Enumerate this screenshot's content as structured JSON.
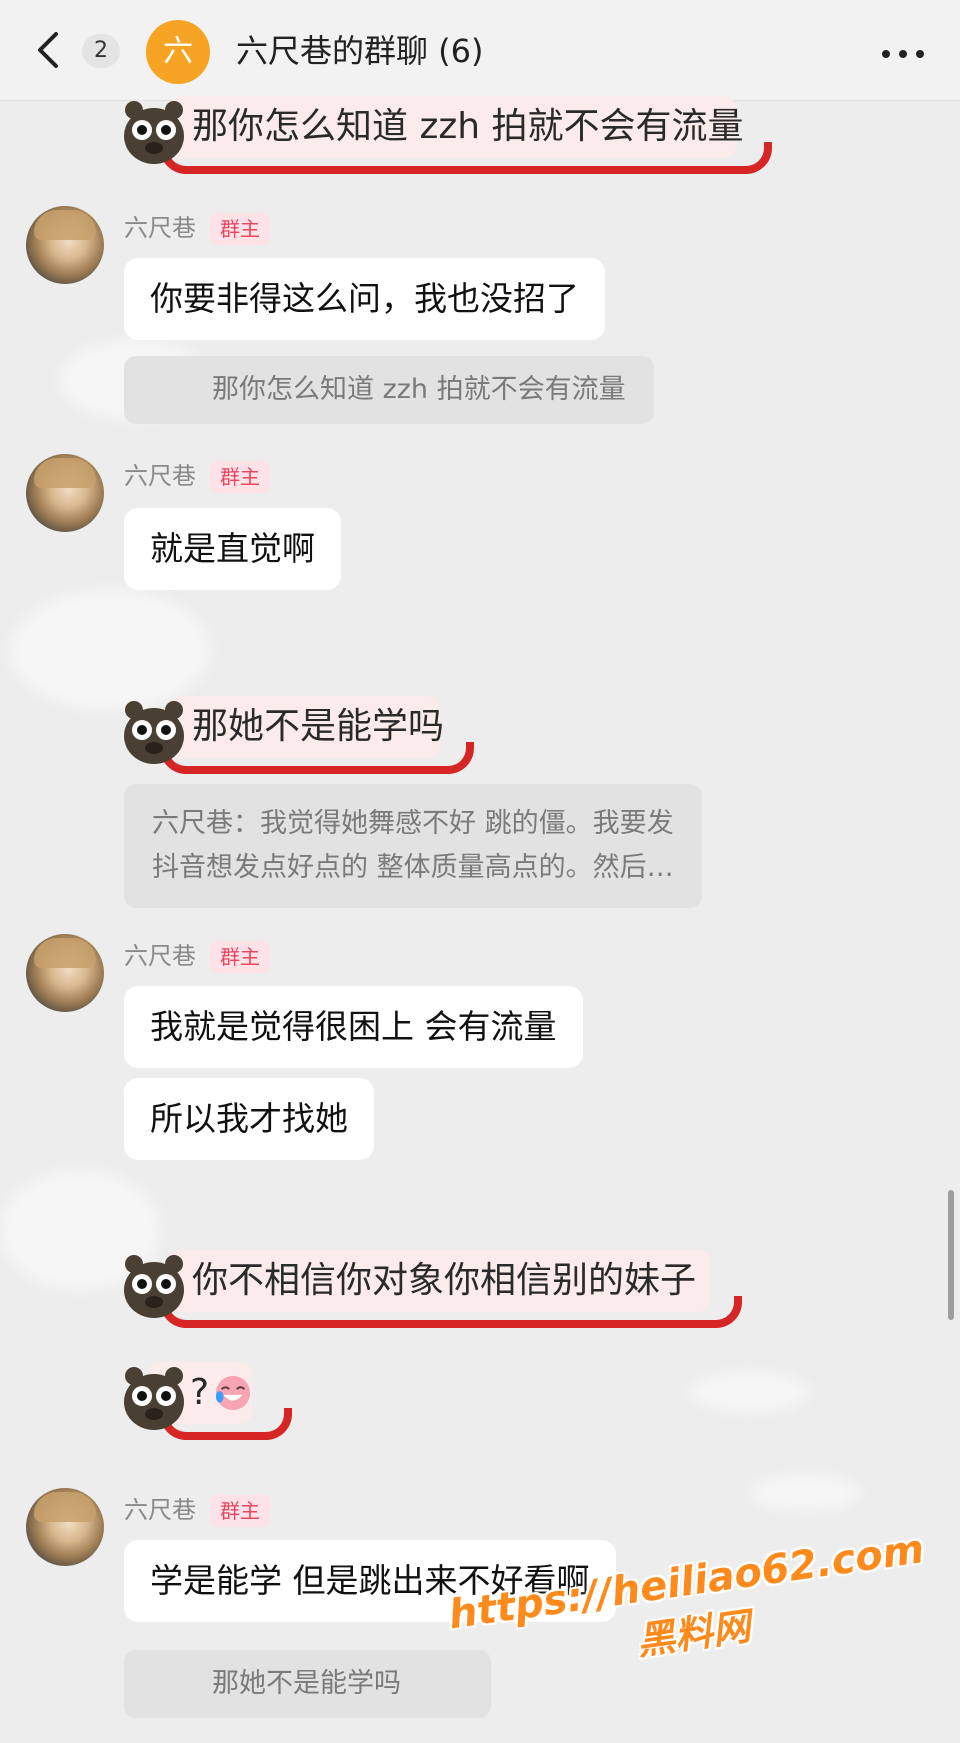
{
  "header": {
    "back_icon": "chevron-left-icon",
    "unread_count": "2",
    "group_avatar_text": "六",
    "title": "六尺巷的群聊 (6)",
    "more_icon": "more-horizontal-icon"
  },
  "messages": {
    "m1_text": "那你怎么知道 zzh 拍就不会有流量",
    "m2_name": "六尺巷",
    "m2_badge": "群主",
    "m2_text": "你要非得这么问，我也没招了",
    "m2_quote": "那你怎么知道 zzh 拍就不会有流量",
    "m3_name": "六尺巷",
    "m3_badge": "群主",
    "m3_text": "就是直觉啊",
    "m4_text": "那她不是能学吗",
    "m4_quote_line1": "六尺巷：我觉得她舞感不好 跳的僵。我要发",
    "m4_quote_line2": "抖音想发点好点的 整体质量高点的。然后…",
    "m5_name": "六尺巷",
    "m5_badge": "群主",
    "m5_text1": "我就是觉得很困上 会有流量",
    "m5_text2": "所以我才找她",
    "m6_text": "你不相信你对象你相信别的妹子",
    "m7_text": "?",
    "m7_emoji": "cry-laugh-emoji-icon",
    "m8_name": "六尺巷",
    "m8_badge": "群主",
    "m8_text": "学是能学 但是跳出来不好看啊",
    "m8_quote": "那她不是能学吗"
  },
  "watermark": {
    "url": "https://heiliao62.com",
    "site": "黑料网"
  },
  "colors": {
    "background": "#ededed",
    "bubble": "#ffffff",
    "quote": "#e2e2e2",
    "owner_badge_text": "#e64660",
    "sticker_underline": "#d62525",
    "group_avatar": "#f7a323",
    "watermark": "#ff8a1c"
  }
}
